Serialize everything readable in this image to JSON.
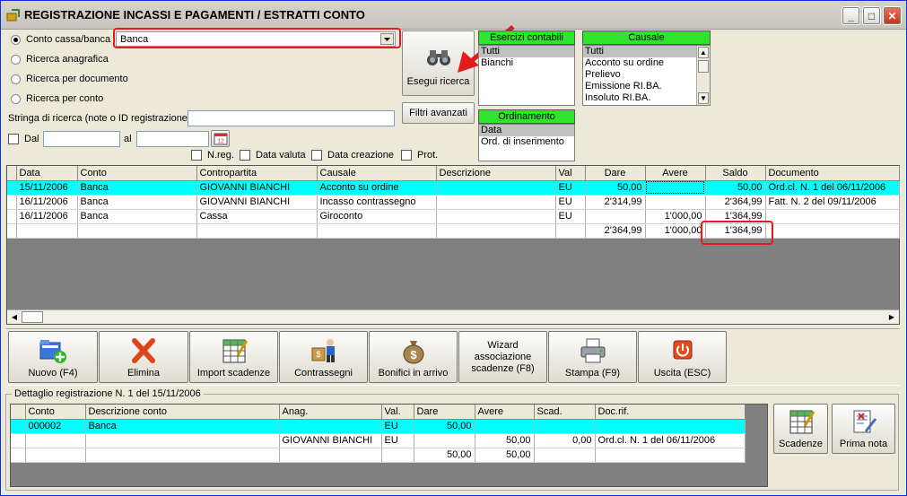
{
  "window": {
    "title": "REGISTRAZIONE INCASSI E PAGAMENTI / ESTRATTI CONTO",
    "min": "_",
    "max": "□",
    "close": "✕"
  },
  "search": {
    "radio_conto": "Conto cassa/banca",
    "conto_value": "Banca",
    "radio_anagrafica": "Ricerca anagrafica",
    "radio_documento": "Ricerca per documento",
    "radio_perconto": "Ricerca per conto",
    "stringa_label": "Stringa di ricerca (note o ID registrazione)",
    "dal_label": "Dal",
    "al_label": "al",
    "calendar_day": "12",
    "nreg": "N.reg.",
    "data_valuta": "Data valuta",
    "data_creazione": "Data creazione",
    "prot": "Prot.",
    "esegui": "Esegui ricerca",
    "filtri": "Filtri avanzati"
  },
  "esercizi": {
    "header": "Esercizi contabili",
    "items": [
      "Tutti",
      "Bianchi"
    ]
  },
  "ordinamento": {
    "header": "Ordinamento",
    "items": [
      "Data",
      "Ord. di inserimento"
    ]
  },
  "causale": {
    "header": "Causale",
    "items": [
      "Tutti",
      "Acconto su ordine",
      "Prelievo",
      "Emissione RI.BA.",
      "Insoluto RI.BA."
    ]
  },
  "main_grid": {
    "headers": [
      "Data",
      "Conto",
      "Contropartita",
      "Causale",
      "Descrizione",
      "Val",
      "Dare",
      "Avere",
      "Saldo",
      "Documento"
    ],
    "rows": [
      [
        "15/11/2006",
        "Banca",
        "GIOVANNI BIANCHI",
        "Acconto su ordine",
        "",
        "EU",
        "50,00",
        "",
        "50,00",
        "Ord.cl. N. 1 del 06/11/2006"
      ],
      [
        "16/11/2006",
        "Banca",
        "GIOVANNI BIANCHI",
        "Incasso contrassegno",
        "",
        "EU",
        "2'314,99",
        "",
        "2'364,99",
        "Fatt. N. 2 del 09/11/2006"
      ],
      [
        "16/11/2006",
        "Banca",
        "Cassa",
        "Giroconto",
        "",
        "EU",
        "",
        "1'000,00",
        "1'364,99",
        ""
      ],
      [
        "",
        "",
        "",
        "",
        "",
        "",
        "2'364,99",
        "1'000,00",
        "1'364,99",
        ""
      ]
    ]
  },
  "toolbar": [
    {
      "label": "Nuovo (F4)"
    },
    {
      "label": "Elimina"
    },
    {
      "label": "Import scadenze"
    },
    {
      "label": "Contrassegni"
    },
    {
      "label": "Bonifici in arrivo"
    },
    {
      "label": "Wizard associazione scadenze (F8)"
    },
    {
      "label": "Stampa (F9)"
    },
    {
      "label": "Uscita (ESC)"
    }
  ],
  "detail": {
    "title": "Dettaglio registrazione N. 1 del 15/11/2006",
    "headers": [
      "Conto",
      "Descrizione conto",
      "Anag.",
      "Val.",
      "Dare",
      "Avere",
      "Scad.",
      "Doc.rif."
    ],
    "rows": [
      [
        "000002",
        "Banca",
        "",
        "EU",
        "50,00",
        "",
        "",
        ""
      ],
      [
        "",
        "",
        "GIOVANNI BIANCHI",
        "EU",
        "",
        "50,00",
        "0,00",
        "Ord.cl. N. 1 del 06/11/2006"
      ],
      [
        "",
        "",
        "",
        "",
        "50,00",
        "50,00",
        "",
        ""
      ]
    ],
    "btn_scadenze": "Scadenze",
    "btn_prima_nota": "Prima nota"
  }
}
